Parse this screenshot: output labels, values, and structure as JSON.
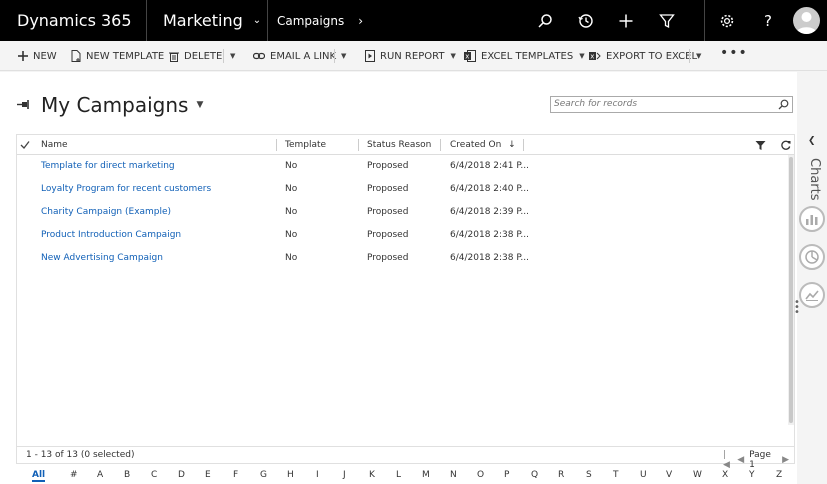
{
  "nav": {
    "brand": "Dynamics 365",
    "module": "Marketing",
    "area": "Campaigns"
  },
  "commands": {
    "new": "NEW",
    "new_template": "NEW TEMPLATE",
    "delete": "DELETE",
    "email_link": "EMAIL A LINK",
    "run_report": "RUN REPORT",
    "excel_templates": "EXCEL TEMPLATES",
    "export_excel": "EXPORT TO EXCEL"
  },
  "view": {
    "title": "My Campaigns",
    "search_placeholder": "Search for records"
  },
  "grid": {
    "columns": [
      "Name",
      "Template",
      "Status Reason",
      "Created On"
    ],
    "rows": [
      {
        "name": "Template for direct marketing",
        "template": "No",
        "status": "Proposed",
        "created": "6/4/2018 2:41 P..."
      },
      {
        "name": "Loyalty Program for recent customers",
        "template": "No",
        "status": "Proposed",
        "created": "6/4/2018 2:40 P..."
      },
      {
        "name": "Charity Campaign (Example)",
        "template": "No",
        "status": "Proposed",
        "created": "6/4/2018 2:39 P..."
      },
      {
        "name": "Product Introduction Campaign",
        "template": "No",
        "status": "Proposed",
        "created": "6/4/2018 2:38 P..."
      },
      {
        "name": "New Advertising Campaign",
        "template": "No",
        "status": "Proposed",
        "created": "6/4/2018 2:38 P..."
      }
    ],
    "record_count": "1 - 13 of 13 (0 selected)",
    "page_label": "Page 1"
  },
  "alpha": [
    "All",
    "#",
    "A",
    "B",
    "C",
    "D",
    "E",
    "F",
    "G",
    "H",
    "I",
    "J",
    "K",
    "L",
    "M",
    "N",
    "O",
    "P",
    "Q",
    "R",
    "S",
    "T",
    "U",
    "V",
    "W",
    "X",
    "Y",
    "Z"
  ],
  "charts_label": "Charts",
  "colors": {
    "nav_bg": "#000000",
    "link": "#1160b7",
    "command_bar_bg": "#f4f4f4"
  }
}
